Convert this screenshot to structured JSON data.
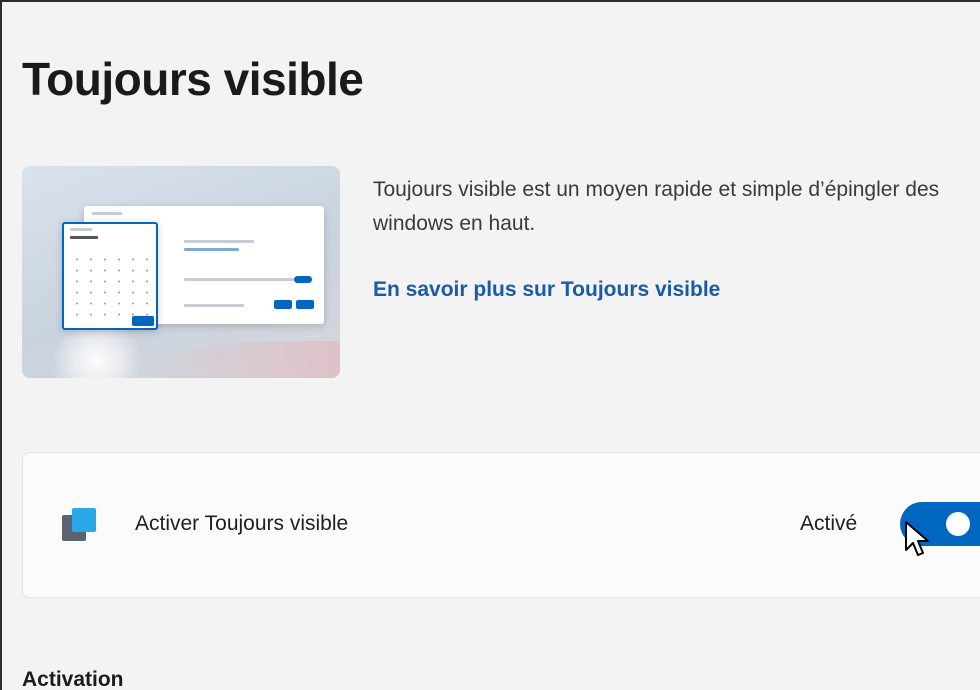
{
  "page": {
    "title": "Toujours visible"
  },
  "intro": {
    "description": "Toujours visible est un moyen rapide et simple d’épingler des windows en haut.",
    "learn_more_link": "En savoir plus sur Toujours visible"
  },
  "setting": {
    "icon": "always-on-top-icon",
    "label": "Activer Toujours visible",
    "state_label": "Activé",
    "enabled": true,
    "accent_color": "#0067c0"
  },
  "section": {
    "title": "Activation"
  },
  "colors": {
    "background": "#f3f3f3",
    "card": "#fbfbfb",
    "link": "#1a5aa6",
    "icon_front": "#29a9ea",
    "icon_back": "#5a6470"
  }
}
